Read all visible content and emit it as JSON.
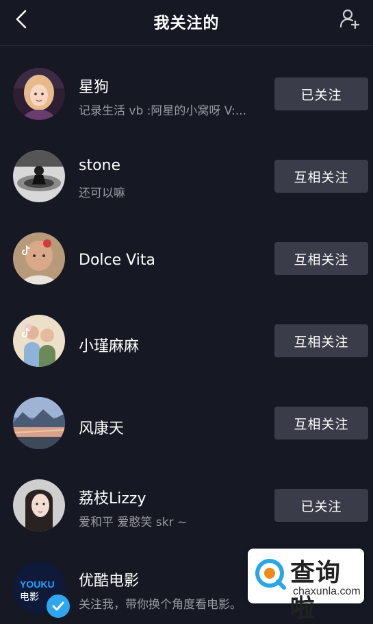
{
  "header": {
    "title": "我关注的",
    "back_icon": "chevron-left-icon",
    "add_icon": "add-user-icon"
  },
  "colors": {
    "background": "#161823",
    "button": "#3a3c49",
    "secondary_text": "#9a9ba3",
    "verified": "#2fa7f0"
  },
  "users": [
    {
      "name": "星狗",
      "bio": "记录生活 vb :阿星的小窝呀 V:...",
      "button": "已关注"
    },
    {
      "name": "stone",
      "bio": "还可以嘛",
      "button": "互相关注"
    },
    {
      "name": "Dolce Vita",
      "bio": "",
      "button": "互相关注"
    },
    {
      "name": "小瑾麻麻",
      "bio": "",
      "button": "互相关注"
    },
    {
      "name": "风康天",
      "bio": "",
      "button": "互相关注"
    },
    {
      "name": "荔枝Lizzy",
      "bio": "爱和平 爱憨笑 skr ~",
      "button": "已关注"
    },
    {
      "name": "优酷电影",
      "bio": "关注我，带你换个角度看电影。",
      "button": "",
      "avatar_text": "YOUKU",
      "avatar_text2": "电影",
      "verified": true
    }
  ],
  "watermark": {
    "main": "查询啦",
    "sub": "chaxunla.com"
  }
}
